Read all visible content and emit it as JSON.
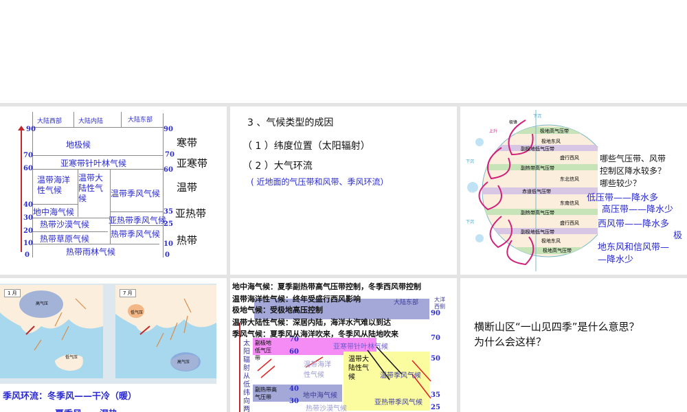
{
  "slide1": {
    "headers": [
      "大陆西部",
      "大陆内陆",
      "大陆东部"
    ],
    "left_ticks": [
      "90",
      "70",
      "60",
      "40",
      "30",
      "20",
      "10",
      "0"
    ],
    "right_ticks": [
      "90",
      "70",
      "60",
      "35",
      "25",
      "10",
      "0"
    ],
    "cells": [
      "地极候",
      "亚寒带针叶林气候",
      "温带海洋性气候",
      "温带大陆性气候",
      "温带季风气候",
      "地中海气候",
      "亚热带季风气候",
      "热带沙漠气候",
      "热带季风气候",
      "热带草原气候",
      "热带雨林气候"
    ],
    "zones": [
      "寒带",
      "亚寒带",
      "温带",
      "亚热带",
      "热带"
    ]
  },
  "slide2": {
    "title": "3 、气候类型的成因",
    "item1": "（ 1 ）纬度位置（太阳辐射）",
    "item2": "（ 2 ）大气环流",
    "note": "( 近地面的气压带和风带、季风环流）"
  },
  "slide3": {
    "bands": [
      "极地高气压带",
      "极地东风",
      "副极地低气压带",
      "盛行西风",
      "副热带高气压带",
      "东北信风",
      "赤道低气压带",
      "东南信风",
      "副热带高气压带",
      "盛行西风",
      "副极地低气压带",
      "极地东风",
      "极地高气压带"
    ],
    "side_labels": [
      "下沉",
      "上升",
      "下沉",
      "极锋",
      "下沉",
      "上升"
    ],
    "question": [
      "哪些气压带、风带",
      "控制区降水较多？",
      "哪些较少？"
    ],
    "answers": [
      "低压带——降水多",
      "高压带——降水少",
      "西风带——降水多",
      "极",
      "地东风和信风带—",
      "—降水少"
    ]
  },
  "slide4": {
    "map1_label": "1 月",
    "map2_label": "7 月",
    "map1_high": "高气压",
    "map1_low": "低气压",
    "map2_low": "低气压",
    "map2_high": "高气压",
    "line1": "季风环流：冬季风——干冷（暖）",
    "line2": "夏季风——湿热"
  },
  "slide5": {
    "lines": [
      "地中海气候：夏季副热带高气压带控制，冬季西风带控制",
      "温带海洋性气候：终年受盛行西风影响",
      "极地气候：受极地高压控制",
      "温带大陆性气候：深居内陆，海洋水汽难以到达",
      "季风气候：夏季风从海洋吹来，冬季风从陆地吹来"
    ],
    "headers": [
      "大陆东部",
      "大洋西侧"
    ],
    "cells": [
      "亚寒带针叶林气候",
      "温带海洋性气候",
      "温带大陆性气候",
      "温带季风气候",
      "地中海气候",
      "亚热带季风气候",
      "热带沙漠气候"
    ],
    "belts": [
      "副极地低气压带",
      "副热带高气压带"
    ],
    "vertical": "太阳辐射从低纬向两极",
    "ticks": [
      "90",
      "70",
      "60",
      "40",
      "30",
      "90",
      "70",
      "50",
      "35",
      "25"
    ]
  },
  "slide6": {
    "question": [
      "横断山区“一山见四季”是什么意思？",
      "为什么会这样？"
    ]
  },
  "colors": {
    "text_blue": "#2a2ad0",
    "arrow_red": "#c0282e",
    "band_purple": "#d7c6e4",
    "band_green": "#c7e3b8",
    "globe_fill": "#fbeedc",
    "highlight_yellow": "#fbfba0",
    "highlight_pink": "#f58cf5",
    "belt_blue": "#a4a8d8"
  }
}
